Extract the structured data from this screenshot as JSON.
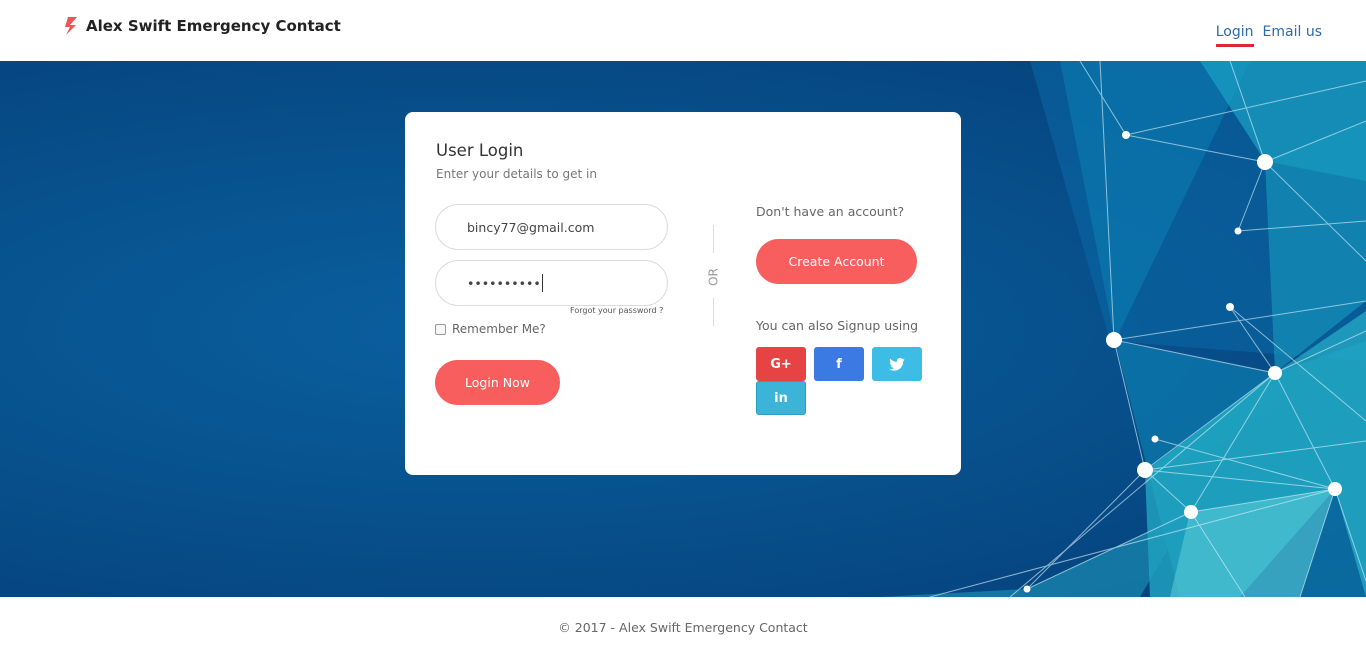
{
  "header": {
    "brand_name": "Alex Swift Emergency Contact",
    "nav": {
      "login": "Login",
      "email": "Email us"
    }
  },
  "login_card": {
    "title": "User Login",
    "subtitle": "Enter your details to get in",
    "email_value": "bincy77@gmail.com",
    "password_value": "••••••••••",
    "forgot_password": "Forgot your password ?",
    "remember_me": "Remember Me?",
    "login_button": "Login Now",
    "or_text": "OR",
    "no_account": "Don't have an account?",
    "create_account_button": "Create Account",
    "signup_using": "You can also Signup using",
    "social": {
      "google": "G+",
      "facebook": "f",
      "linkedin": "in"
    }
  },
  "footer": {
    "text": "© 2017 - Alex Swift Emergency Contact"
  },
  "colors": {
    "accent": "#f95e5e",
    "hero_bg": "#07528e",
    "nav_link": "#2d6aa8",
    "nav_underline": "#e0253a",
    "google": "#e64444",
    "facebook": "#3b79e3",
    "twitter": "#3dbde6",
    "linkedin": "#3cb4d8"
  }
}
